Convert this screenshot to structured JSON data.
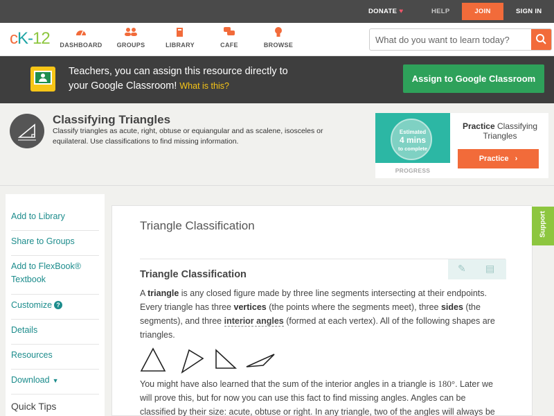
{
  "topbar": {
    "donate": "DONATE",
    "help": "HELP",
    "join": "JOIN",
    "signin": "SIGN IN"
  },
  "nav": {
    "logo_c": "c",
    "logo_k": "K",
    "logo_dash": "-",
    "logo_n": "12",
    "items": [
      {
        "label": "DASHBOARD",
        "icon": "gauge-icon"
      },
      {
        "label": "GROUPS",
        "icon": "people-icon"
      },
      {
        "label": "LIBRARY",
        "icon": "book-icon"
      },
      {
        "label": "CAFE",
        "icon": "chat-icon"
      },
      {
        "label": "BROWSE",
        "icon": "lightbulb-icon"
      }
    ],
    "search_placeholder": "What do you want to learn today?"
  },
  "banner": {
    "line1": "Teachers, you can assign this resource directly to",
    "line2": "your Google Classroom!",
    "what": "What is this?",
    "assign": "Assign to Google Classroom"
  },
  "concept": {
    "title": "Classifying Triangles",
    "description": "Classify triangles as acute, right, obtuse or equiangular and as scalene, isosceles or equilateral. Use classifications to find missing information."
  },
  "practice_card": {
    "estimated": "Estimated",
    "minutes": "4 mins",
    "to_complete": "to complete",
    "progress": "PROGRESS",
    "title_bold": "Practice",
    "title_rest": "Classifying Triangles",
    "button": "Practice"
  },
  "sidebar": {
    "items": [
      "Add to Library",
      "Share to Groups",
      "Add to FlexBook®",
      "Textbook",
      "Customize",
      "Details",
      "Resources",
      "Download"
    ],
    "quick_tips": "Quick Tips"
  },
  "main": {
    "title": "Triangle Classification",
    "section_title": "Triangle Classification",
    "p1": {
      "a": "A ",
      "triangle": "triangle",
      "b": " is any closed figure made by three line segments intersecting at their endpoints. Every triangle has three ",
      "vertices": "vertices",
      "c": " (the points where the segments meet), three ",
      "sides": "sides",
      "d": " (the segments), and three ",
      "interior": "interior angles",
      "e": " (formed at each vertex). All of the following shapes are triangles."
    },
    "p2": {
      "a": "You might have also learned that the sum of the interior angles in a triangle is ",
      "deg": "180°",
      "b": ". Later we will prove this, but for now you can use this fact to find missing angles. Angles can be classified by their size: acute, obtuse or right. In any triangle, two of the angles will always be acute. The"
    }
  },
  "support": "Support",
  "colors": {
    "accent_orange": "#f26b3a",
    "teal": "#1c8c8c",
    "green": "#2ea15a",
    "support_green": "#8dc63f"
  }
}
